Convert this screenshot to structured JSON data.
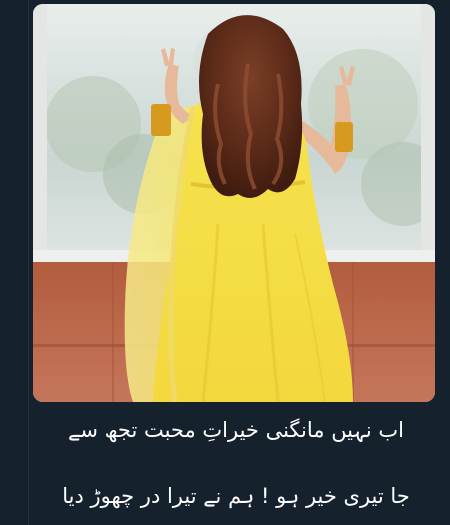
{
  "post": {
    "caption_line_1": "اب نہیں مانگنی خیراتِ محبت تجھ سے",
    "caption_line_2": "جا تیری خیر ہو ! ہم نے تیرا در چھوڑ دیا"
  },
  "image": {
    "subject": "woman-in-yellow-dress-at-window"
  },
  "colors": {
    "background": "#15212d",
    "text": "#ffffff",
    "dress": "#f2e04a",
    "wall": "#b5654a"
  }
}
